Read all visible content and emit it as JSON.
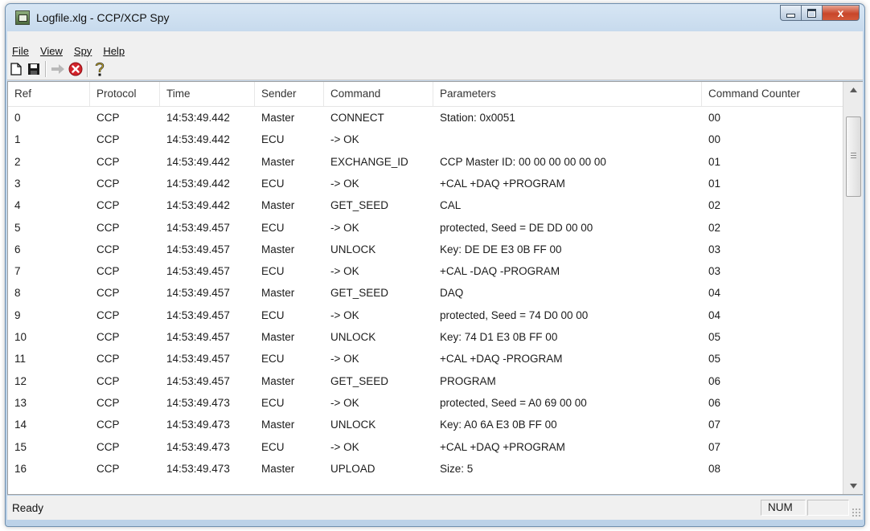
{
  "window": {
    "title": "Logfile.xlg - CCP/XCP Spy",
    "close_glyph": "x"
  },
  "menu": [
    "File",
    "View",
    "Spy",
    "Help"
  ],
  "toolbar": {
    "buttons": [
      {
        "name": "new-file-icon"
      },
      {
        "name": "save-icon"
      },
      {
        "name": "start-arrow-icon",
        "disabled": true
      },
      {
        "name": "stop-icon"
      },
      {
        "name": "help-icon"
      }
    ]
  },
  "table": {
    "columns": [
      "Ref",
      "Protocol",
      "Time",
      "Sender",
      "Command",
      "Parameters",
      "Command Counter"
    ],
    "rows": [
      [
        "0",
        "CCP",
        "14:53:49.442",
        "Master",
        "CONNECT",
        "Station: 0x0051",
        "00"
      ],
      [
        "1",
        "CCP",
        "14:53:49.442",
        "ECU",
        " -> OK",
        "",
        "00"
      ],
      [
        "2",
        "CCP",
        "14:53:49.442",
        "Master",
        "EXCHANGE_ID",
        "CCP Master ID: 00 00 00 00 00 00",
        "01"
      ],
      [
        "3",
        "CCP",
        "14:53:49.442",
        "ECU",
        " -> OK",
        "+CAL +DAQ +PROGRAM",
        "01"
      ],
      [
        "4",
        "CCP",
        "14:53:49.442",
        "Master",
        "GET_SEED",
        "CAL",
        "02"
      ],
      [
        "5",
        "CCP",
        "14:53:49.457",
        "ECU",
        " -> OK",
        "protected, Seed = DE DD 00 00",
        "02"
      ],
      [
        "6",
        "CCP",
        "14:53:49.457",
        "Master",
        "UNLOCK",
        "Key: DE DE E3 0B FF 00",
        "03"
      ],
      [
        "7",
        "CCP",
        "14:53:49.457",
        "ECU",
        " -> OK",
        "+CAL -DAQ -PROGRAM",
        "03"
      ],
      [
        "8",
        "CCP",
        "14:53:49.457",
        "Master",
        "GET_SEED",
        "DAQ",
        "04"
      ],
      [
        "9",
        "CCP",
        "14:53:49.457",
        "ECU",
        " -> OK",
        "protected, Seed = 74 D0 00 00",
        "04"
      ],
      [
        "10",
        "CCP",
        "14:53:49.457",
        "Master",
        "UNLOCK",
        "Key: 74 D1 E3 0B FF 00",
        "05"
      ],
      [
        "11",
        "CCP",
        "14:53:49.457",
        "ECU",
        " -> OK",
        "+CAL +DAQ -PROGRAM",
        "05"
      ],
      [
        "12",
        "CCP",
        "14:53:49.457",
        "Master",
        "GET_SEED",
        "PROGRAM",
        "06"
      ],
      [
        "13",
        "CCP",
        "14:53:49.473",
        "ECU",
        " -> OK",
        "protected, Seed = A0 69 00 00",
        "06"
      ],
      [
        "14",
        "CCP",
        "14:53:49.473",
        "Master",
        "UNLOCK",
        "Key: A0 6A E3 0B FF 00",
        "07"
      ],
      [
        "15",
        "CCP",
        "14:53:49.473",
        "ECU",
        " -> OK",
        "+CAL +DAQ +PROGRAM",
        "07"
      ],
      [
        "16",
        "CCP",
        "14:53:49.473",
        "Master",
        "UPLOAD",
        "Size: 5",
        "08"
      ]
    ]
  },
  "status": {
    "text": "Ready",
    "num": "NUM"
  }
}
